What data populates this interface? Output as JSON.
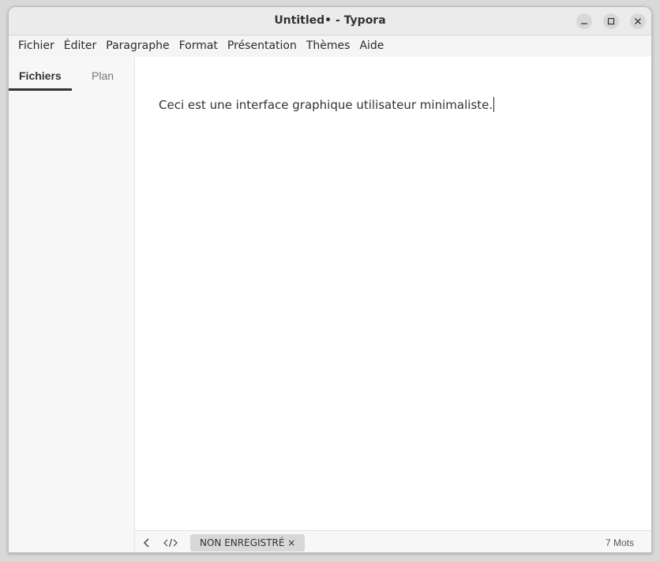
{
  "window": {
    "title": "Untitled• - Typora"
  },
  "menu": {
    "items": [
      "Fichier",
      "Éditer",
      "Paragraphe",
      "Format",
      "Présentation",
      "Thèmes",
      "Aide"
    ]
  },
  "sidebar": {
    "tabs": [
      {
        "label": "Fichiers",
        "active": true
      },
      {
        "label": "Plan",
        "active": false
      }
    ]
  },
  "editor": {
    "content": "Ceci est une interface graphique utilisateur minimaliste."
  },
  "statusbar": {
    "badge": "NON ENREGISTRÉ ×",
    "word_count": "7 Mots"
  },
  "icons": {
    "back": "chevron-left-icon",
    "source_code": "code-icon",
    "minimize": "minimize-icon",
    "maximize": "maximize-icon",
    "close": "close-icon"
  }
}
